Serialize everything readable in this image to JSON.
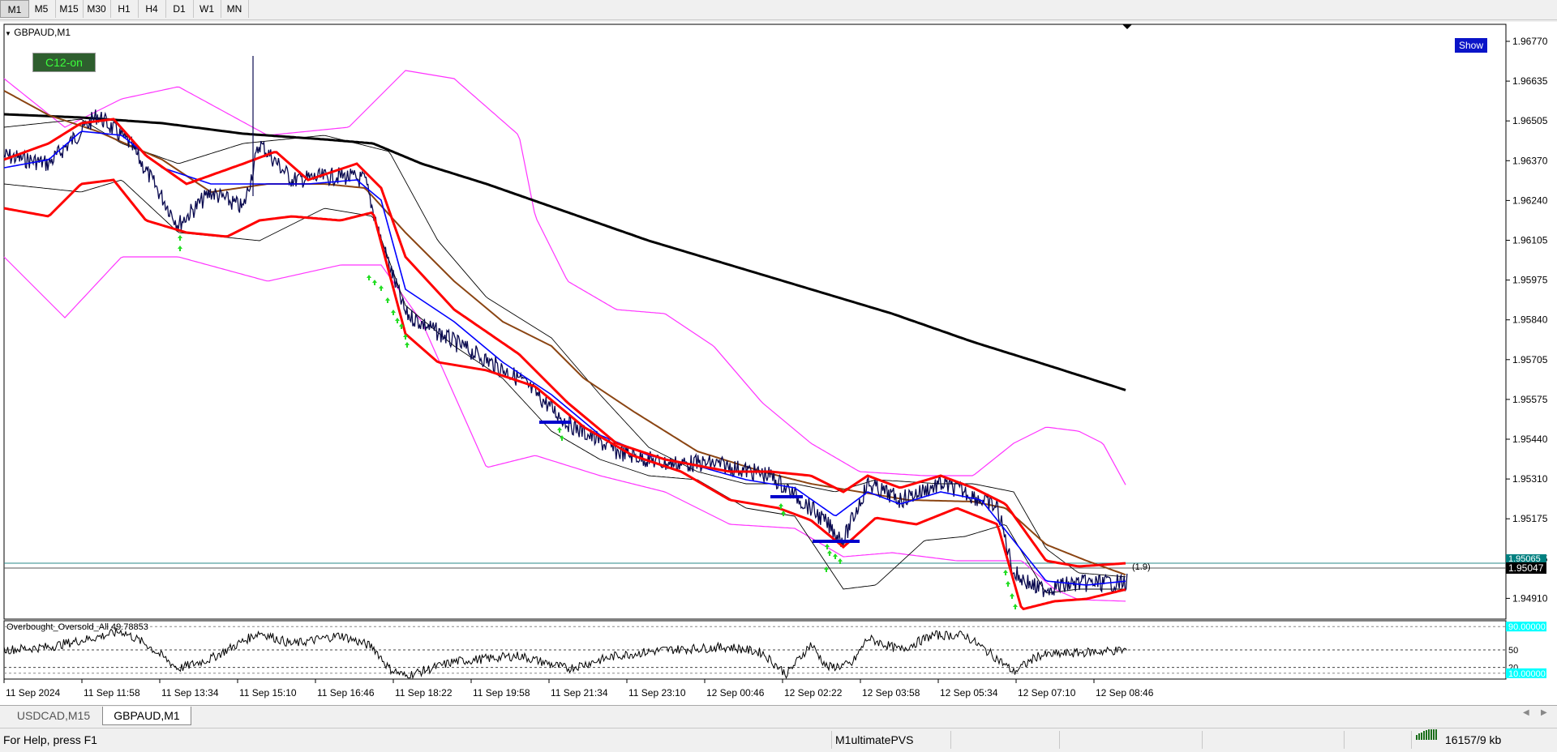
{
  "timeframes": [
    "M1",
    "M5",
    "M15",
    "M30",
    "H1",
    "H4",
    "D1",
    "W1",
    "MN"
  ],
  "active_timeframe": "M1",
  "chart": {
    "symbol_label": "GBPAUD,M1",
    "c12_label": "C12-on",
    "show_button": "Show",
    "price_ticks": [
      "1.96770",
      "1.96635",
      "1.96505",
      "1.96370",
      "1.96240",
      "1.96105",
      "1.95975",
      "1.95840",
      "1.95705",
      "1.95575",
      "1.95440",
      "1.95310",
      "1.95175",
      "1.95045",
      "1.94910"
    ],
    "current_price": "1.95047",
    "partial_price": "1.95065",
    "annotation": "(1.9)",
    "time_ticks": [
      "11 Sep 2024",
      "11 Sep 11:58",
      "11 Sep 13:34",
      "11 Sep 15:10",
      "11 Sep 16:46",
      "11 Sep 18:22",
      "11 Sep 19:58",
      "11 Sep 21:34",
      "11 Sep 23:10",
      "12 Sep 00:46",
      "12 Sep 02:22",
      "12 Sep 03:58",
      "12 Sep 05:34",
      "12 Sep 07:10",
      "12 Sep 08:46"
    ]
  },
  "indicator": {
    "label": "Overbought_Oversold_All 49.78853",
    "level_high": "90.00000",
    "level_mid": "50",
    "level_low": "20",
    "level_bottom": "10.00000"
  },
  "tabs": [
    "USDCAD,M15",
    "GBPAUD,M1"
  ],
  "active_tab": "GBPAUD,M1",
  "status": {
    "help": "For Help, press F1",
    "profile": "M1ultimatePVS",
    "traffic": "16157/9 kb"
  },
  "colors": {
    "price": "#0a0a50",
    "ma_black": "#000000",
    "band_red": "#ff0000",
    "band_magenta": "#ff33ff",
    "ma_brown": "#8b4513",
    "ma_blue": "#0000ff",
    "arrow_green": "#22dd22",
    "axis_label_bg": "#000000",
    "level_cyan": "#00ffff"
  }
}
